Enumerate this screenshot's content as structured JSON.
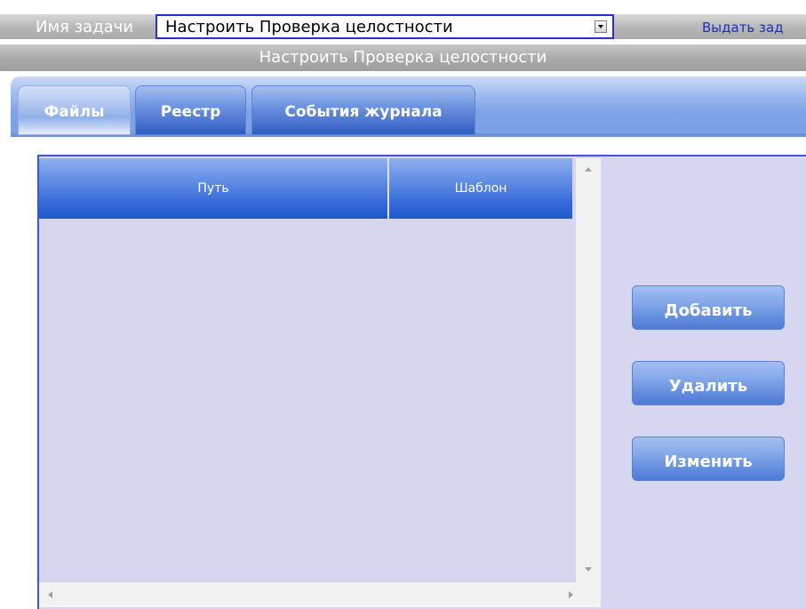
{
  "header": {
    "task_label": "Имя задачи",
    "task_select_value": "Настроить Проверка целостности",
    "issue_link": "Выдать зад",
    "title": "Настроить Проверка целостности"
  },
  "tabs": [
    {
      "label": "Файлы",
      "active": true
    },
    {
      "label": "Реестр",
      "active": false
    },
    {
      "label": "События журнала",
      "active": false
    }
  ],
  "table": {
    "columns": [
      "Путь",
      "Шаблон"
    ],
    "rows": []
  },
  "actions": {
    "add_label": "Добавить",
    "delete_label": "Удалить",
    "edit_label": "Изменить"
  },
  "colors": {
    "accent_blue": "#2f64d6",
    "panel_bg": "#d6d6f0",
    "link": "#1a2fbf",
    "select_border": "#2a2ad6"
  }
}
